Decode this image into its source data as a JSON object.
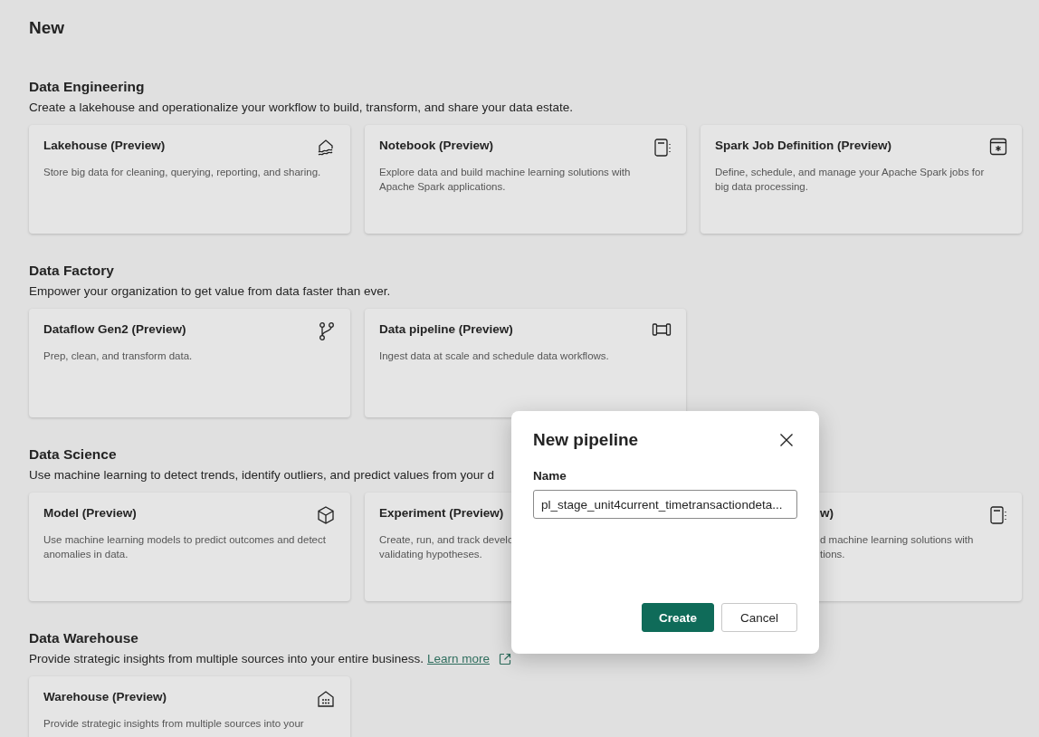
{
  "page": {
    "title": "New"
  },
  "sections": [
    {
      "heading": "Data Engineering",
      "description": "Create a lakehouse and operationalize your workflow to build, transform, and share your data estate.",
      "cards": [
        {
          "kind": "full",
          "title": "Lakehouse (Preview)",
          "description": "Store big data for cleaning, querying, reporting, and sharing."
        },
        {
          "kind": "full",
          "title": "Notebook (Preview)",
          "description": "Explore data and build machine learning solutions with Apache Spark applications."
        },
        {
          "kind": "full",
          "title": "Spark Job Definition (Preview)",
          "description": "Define, schedule, and manage your Apache Spark jobs for big data processing."
        }
      ]
    },
    {
      "heading": "Data Factory",
      "description": "Empower your organization to get value from data faster than ever.",
      "cards": [
        {
          "kind": "full",
          "title": "Dataflow Gen2 (Preview)",
          "description": "Prep, clean, and transform data."
        },
        {
          "kind": "full",
          "title": "Data pipeline (Preview)",
          "description": "Ingest data at scale and schedule data workflows."
        }
      ]
    },
    {
      "heading": "Data Science",
      "description": "Use machine learning to detect trends, identify outliers, and predict values from your d",
      "cards": [
        {
          "kind": "full",
          "title": "Model (Preview)",
          "description": "Use machine learning models to predict outcomes and detect anomalies in data."
        },
        {
          "kind": "cut",
          "title": "Experiment (Preview)",
          "lines": [
            "Create, run, and track develo",
            "validating hypotheses."
          ]
        },
        {
          "kind": "cut-left",
          "title": "w)",
          "lines": [
            "d machine learning solutions with",
            "tions."
          ]
        }
      ]
    },
    {
      "heading": "Data Warehouse",
      "description": "Provide strategic insights from multiple sources into your entire business.",
      "link": "Learn more",
      "cards": [
        {
          "kind": "full",
          "title": "Warehouse (Preview)",
          "description": "Provide strategic insights from multiple sources into your"
        }
      ]
    }
  ],
  "dialog": {
    "title": "New pipeline",
    "field_label": "Name",
    "value": "pl_stage_unit4current_timetransactiondeta...",
    "buttons": [
      {
        "kind": "primary",
        "label": "Create"
      },
      {
        "kind": "secondary",
        "label": "Cancel"
      }
    ]
  }
}
